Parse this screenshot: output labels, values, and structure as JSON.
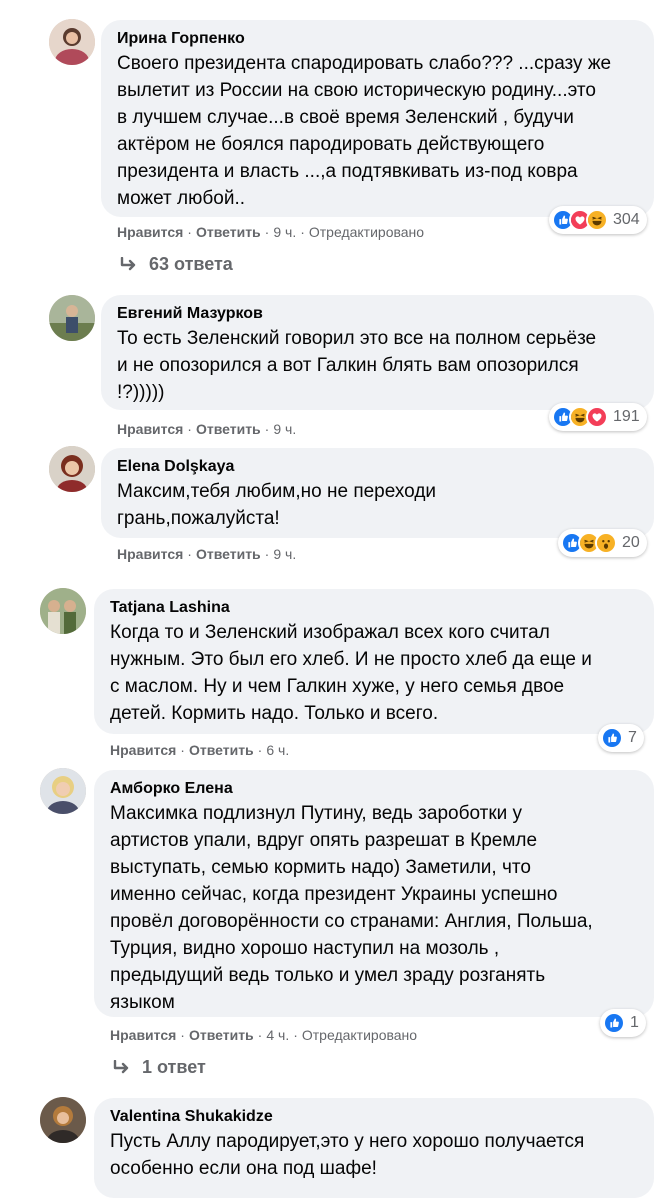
{
  "comments": [
    {
      "author": "Ирина Горпенко",
      "lines": [
        "Своего президента спародировать слабо??? ...сразу же",
        "вылетит из России на свою историческую родину...это",
        "в лучшем случае...в своё время Зеленский , будучи",
        "актёром не боялся пародировать действующего",
        "президента и власть ...,а подтявкивать из-под ковра",
        "может любой.."
      ],
      "reaction_icons": [
        "like-icon",
        "love-icon",
        "haha-icon"
      ],
      "reaction_count": "304",
      "like_label": "Нравится",
      "reply_label": "Ответить",
      "time": "9 ч.",
      "edited": "Отредактировано",
      "replies_label": "63 ответа"
    },
    {
      "author": "Евгений Мазурков",
      "lines": [
        "То есть Зеленский говорил это все на полном серьёзе",
        "и не опозорился а вот Галкин блять вам опозорился",
        "!?)))))"
      ],
      "reaction_icons": [
        "like-icon",
        "haha-icon",
        "love-icon"
      ],
      "reaction_count": "191",
      "like_label": "Нравится",
      "reply_label": "Ответить",
      "time": "9 ч."
    },
    {
      "author": "Elena Dolşkaya",
      "lines": [
        "Максим,тебя любим,но не переходи",
        "грань,пожалуйста!"
      ],
      "reaction_icons": [
        "like-icon",
        "haha-icon",
        "wow-icon"
      ],
      "reaction_count": "20",
      "like_label": "Нравится",
      "reply_label": "Ответить",
      "time": "9 ч."
    },
    {
      "author": "Tatjana Lashina",
      "lines": [
        "Когда то и Зеленский изображал всех кого считал",
        "нужным. Это был его хлеб. И не просто хлеб да еще и",
        "с маслом. Ну и чем Галкин хуже, у него семья двое",
        "детей. Кормить надо. Только и всего."
      ],
      "reaction_icons": [
        "like-icon"
      ],
      "reaction_count": "7",
      "like_label": "Нравится",
      "reply_label": "Ответить",
      "time": "6 ч."
    },
    {
      "author": "Амборко Елена",
      "lines": [
        "Максимка подлизнул Путину, ведь зароботки у",
        "артистов упали, вдруг опять разрешат в Кремле",
        "выступать, семью кормить надо) Заметили, что",
        "именно сейчас, когда президент Украины успешно",
        "провёл договорённости со странами: Англия, Польша,",
        "Турция, видно хорошо наступил на мозоль ,",
        "предыдущий ведь только и умел зраду розганять",
        "языком"
      ],
      "reaction_icons": [
        "like-icon"
      ],
      "reaction_count": "1",
      "like_label": "Нравится",
      "reply_label": "Ответить",
      "time": "4 ч.",
      "edited": "Отредактировано",
      "replies_label": "1 ответ"
    },
    {
      "author": "Valentina Shukakidze",
      "lines": [
        "Пусть Аллу пародирует,это у него хорошо получается",
        "особенно если она под шафе!"
      ]
    }
  ],
  "colors": {
    "bubble": "#f0f2f5",
    "meta": "#65676b",
    "like": "#1877f2",
    "love": "#f33e58",
    "haha": "#f7b125"
  }
}
